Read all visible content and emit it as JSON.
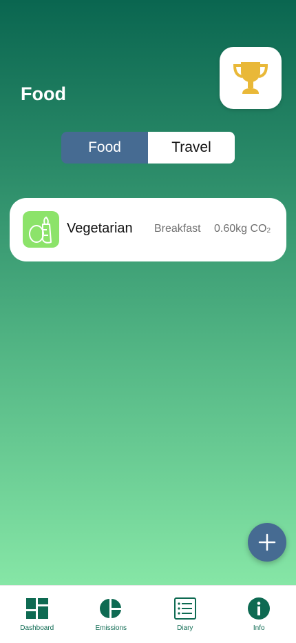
{
  "header": {
    "title": "Food"
  },
  "trophy": {
    "icon": "trophy-icon",
    "color": "#e9b838"
  },
  "segments": [
    {
      "label": "Food",
      "active": true
    },
    {
      "label": "Travel",
      "active": false
    }
  ],
  "entries": [
    {
      "icon": "vegetables-icon",
      "name": "Vegetarian",
      "meal": "Breakfast",
      "co2_value": "0.60kg CO",
      "co2_sub": "2"
    }
  ],
  "fab": {
    "icon": "plus-icon"
  },
  "tabbar": {
    "items": [
      {
        "label": "Dashboard",
        "icon": "dashboard-icon"
      },
      {
        "label": "Emissions",
        "icon": "pie-chart-icon"
      },
      {
        "label": "Diary",
        "icon": "list-icon"
      },
      {
        "label": "Info",
        "icon": "info-icon"
      }
    ]
  },
  "colors": {
    "accent": "#466b92",
    "brand_green": "#0e6a52",
    "icon_green": "#8ce36a"
  }
}
